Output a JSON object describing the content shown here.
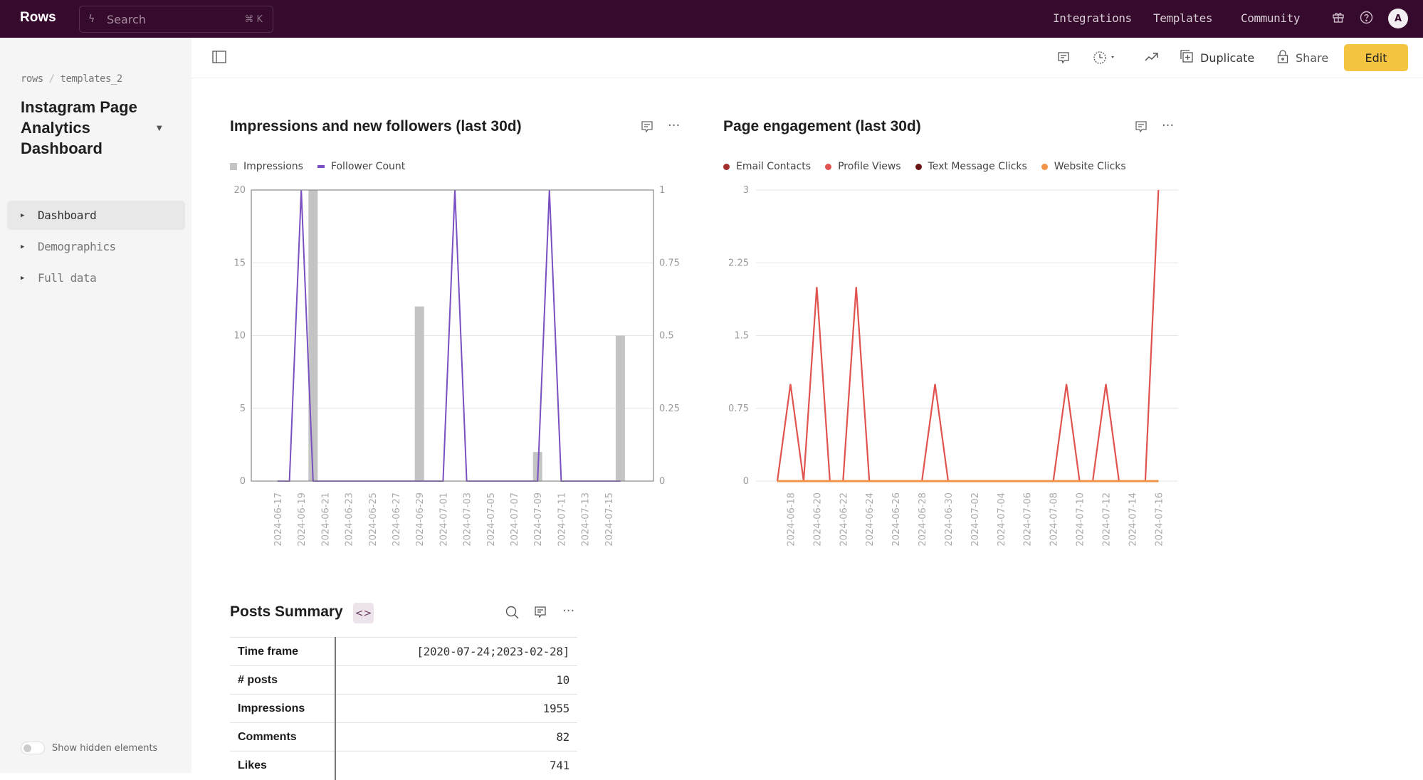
{
  "app": {
    "logo": "Rows"
  },
  "topbar": {
    "search_placeholder": "Search",
    "search_shortcut": "⌘ K",
    "links": [
      "Integrations",
      "Templates",
      "Community"
    ],
    "avatar_initial": "A"
  },
  "sidebar": {
    "breadcrumb": {
      "workspace": "rows",
      "folder": "templates_2"
    },
    "doc_title": "Instagram Page Analytics Dashboard",
    "items": [
      {
        "label": "Dashboard",
        "active": true
      },
      {
        "label": "Demographics",
        "active": false
      },
      {
        "label": "Full data",
        "active": false
      }
    ],
    "show_hidden_label": "Show hidden elements",
    "show_hidden_on": false
  },
  "toolbar": {
    "duplicate_label": "Duplicate",
    "share_label": "Share",
    "edit_label": "Edit"
  },
  "chart_data": [
    {
      "type": "bar+line",
      "title": "Impressions and new followers (last 30d)",
      "dates": [
        "2024-06-17",
        "2024-06-18",
        "2024-06-19",
        "2024-06-20",
        "2024-06-21",
        "2024-06-22",
        "2024-06-23",
        "2024-06-24",
        "2024-06-25",
        "2024-06-26",
        "2024-06-27",
        "2024-06-28",
        "2024-06-29",
        "2024-06-30",
        "2024-07-01",
        "2024-07-02",
        "2024-07-03",
        "2024-07-04",
        "2024-07-05",
        "2024-07-06",
        "2024-07-07",
        "2024-07-08",
        "2024-07-09",
        "2024-07-10",
        "2024-07-11",
        "2024-07-12",
        "2024-07-13",
        "2024-07-14",
        "2024-07-15",
        "2024-07-16"
      ],
      "tick_labels": [
        "2024-06-17",
        "2024-06-19",
        "2024-06-21",
        "2024-06-23",
        "2024-06-25",
        "2024-06-27",
        "2024-06-29",
        "2024-07-01",
        "2024-07-03",
        "2024-07-05",
        "2024-07-07",
        "2024-07-09",
        "2024-07-11",
        "2024-07-13",
        "2024-07-15"
      ],
      "series": [
        {
          "name": "Impressions",
          "kind": "bar",
          "axis": "left",
          "color": "#c4c4c4",
          "values": [
            0,
            0,
            0,
            20,
            0,
            0,
            0,
            0,
            0,
            0,
            0,
            0,
            12,
            0,
            0,
            0,
            0,
            0,
            0,
            0,
            0,
            0,
            2,
            0,
            0,
            0,
            0,
            0,
            0,
            10
          ]
        },
        {
          "name": "Follower Count",
          "kind": "line",
          "axis": "right",
          "color": "#7a4fc1",
          "values": [
            0,
            0,
            1,
            0,
            0,
            0,
            0,
            0,
            0,
            0,
            0,
            0,
            0,
            0,
            0,
            1,
            0,
            0,
            0,
            0,
            0,
            0,
            0,
            1,
            0,
            0,
            0,
            0,
            0,
            0
          ]
        }
      ],
      "y_left": {
        "min": 0,
        "max": 20,
        "ticks": [
          "0",
          "5",
          "10",
          "15",
          "20"
        ]
      },
      "y_right": {
        "min": 0,
        "max": 1,
        "ticks": [
          "0",
          "0.25",
          "0.5",
          "0.75",
          "1"
        ]
      },
      "legend": "top-left",
      "grid": true
    },
    {
      "type": "line",
      "title": "Page engagement (last 30d)",
      "dates": [
        "2024-06-17",
        "2024-06-18",
        "2024-06-19",
        "2024-06-20",
        "2024-06-21",
        "2024-06-22",
        "2024-06-23",
        "2024-06-24",
        "2024-06-25",
        "2024-06-26",
        "2024-06-27",
        "2024-06-28",
        "2024-06-29",
        "2024-06-30",
        "2024-07-01",
        "2024-07-02",
        "2024-07-03",
        "2024-07-04",
        "2024-07-05",
        "2024-07-06",
        "2024-07-07",
        "2024-07-08",
        "2024-07-09",
        "2024-07-10",
        "2024-07-11",
        "2024-07-12",
        "2024-07-13",
        "2024-07-14",
        "2024-07-15",
        "2024-07-16"
      ],
      "tick_labels": [
        "2024-06-18",
        "2024-06-20",
        "2024-06-22",
        "2024-06-24",
        "2024-06-26",
        "2024-06-28",
        "2024-06-30",
        "2024-07-02",
        "2024-07-04",
        "2024-07-06",
        "2024-07-08",
        "2024-07-10",
        "2024-07-12",
        "2024-07-14",
        "2024-07-16"
      ],
      "series": [
        {
          "name": "Email Contacts",
          "color": "#a52f2f",
          "values": [
            0,
            0,
            0,
            0,
            0,
            0,
            0,
            0,
            0,
            0,
            0,
            0,
            0,
            0,
            0,
            0,
            0,
            0,
            0,
            0,
            0,
            0,
            0,
            0,
            0,
            0,
            0,
            0,
            0,
            0
          ]
        },
        {
          "name": "Profile Views",
          "color": "#e0534f",
          "values": [
            0,
            1,
            0,
            2,
            0,
            0,
            2,
            0,
            0,
            0,
            0,
            0,
            1,
            0,
            0,
            0,
            0,
            0,
            0,
            0,
            0,
            0,
            1,
            0,
            0,
            1,
            0,
            0,
            0,
            3
          ]
        },
        {
          "name": "Text Message Clicks",
          "color": "#6b1414",
          "values": [
            0,
            0,
            0,
            0,
            0,
            0,
            0,
            0,
            0,
            0,
            0,
            0,
            0,
            0,
            0,
            0,
            0,
            0,
            0,
            0,
            0,
            0,
            0,
            0,
            0,
            0,
            0,
            0,
            0,
            0
          ]
        },
        {
          "name": "Website Clicks",
          "color": "#f0944a",
          "values": [
            0,
            0,
            0,
            0,
            0,
            0,
            0,
            0,
            0,
            0,
            0,
            0,
            0,
            0,
            0,
            0,
            0,
            0,
            0,
            0,
            0,
            0,
            0,
            0,
            0,
            0,
            0,
            0,
            0,
            0
          ]
        }
      ],
      "y": {
        "min": 0,
        "max": 3,
        "ticks": [
          "0",
          "0.75",
          "1.5",
          "2.25",
          "3"
        ]
      },
      "legend": "top-left",
      "grid": true
    }
  ],
  "posts_summary": {
    "title": "Posts Summary",
    "code_badge": "<>",
    "rows": [
      {
        "label": "Time frame",
        "value": "[2020-07-24;2023-02-28]"
      },
      {
        "label": "# posts",
        "value": "10"
      },
      {
        "label": "Impressions",
        "value": "1955"
      },
      {
        "label": "Comments",
        "value": "82"
      },
      {
        "label": "Likes",
        "value": "741"
      }
    ]
  }
}
